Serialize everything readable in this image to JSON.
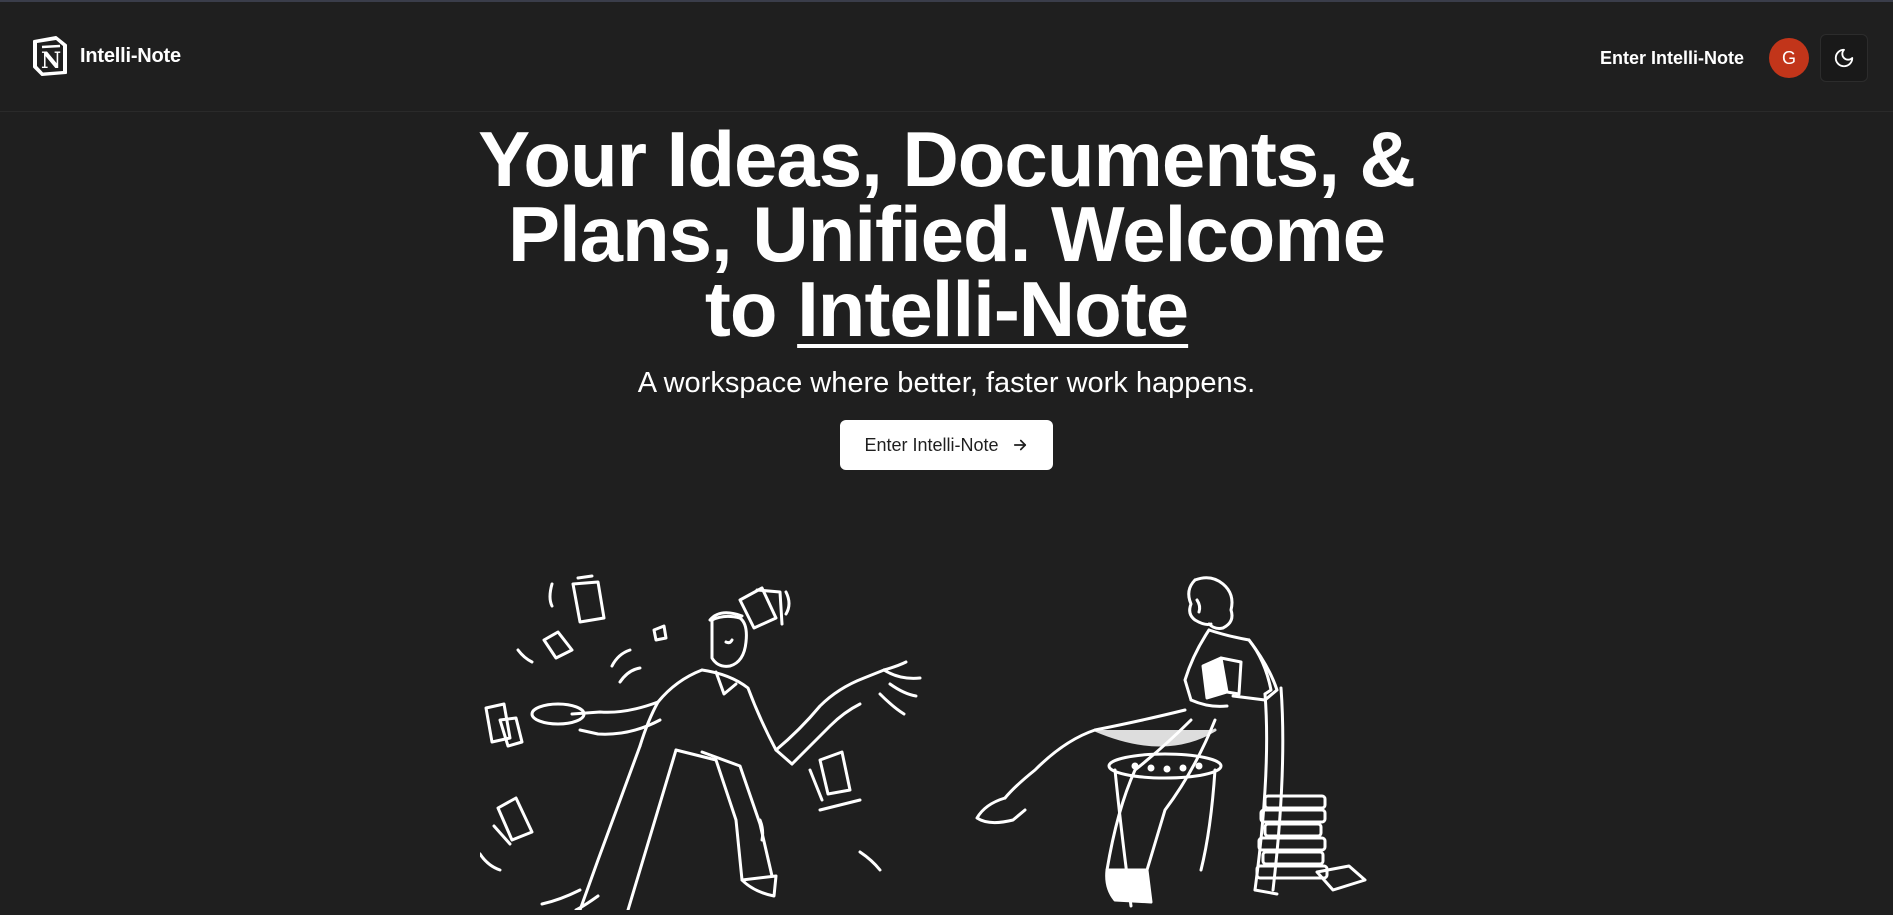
{
  "app": {
    "name": "Intelli-Note"
  },
  "navbar": {
    "logo_text": "Intelli-Note",
    "logo_icon": "notion-n-logo",
    "enter_link": "Enter Intelli-Note",
    "avatar_initial": "G",
    "avatar_color": "#c2351a",
    "theme_toggle_icon": "moon-icon"
  },
  "hero": {
    "headline_line1": "Your Ideas, Documents, &",
    "headline_line2": "Plans, Unified. Welcome",
    "headline_to": "to ",
    "headline_brand": "Intelli-Note",
    "subtitle": "A workspace where better, faster work happens.",
    "cta_label": "Enter Intelli-Note",
    "cta_icon": "arrow-right-icon"
  },
  "illustrations": {
    "left": "juggling-papers-man",
    "right": "woman-reading-in-chair"
  },
  "colors": {
    "background": "#1f1f1f",
    "text": "#ffffff",
    "button_bg": "#ffffff",
    "button_text": "#1f1f1f"
  }
}
